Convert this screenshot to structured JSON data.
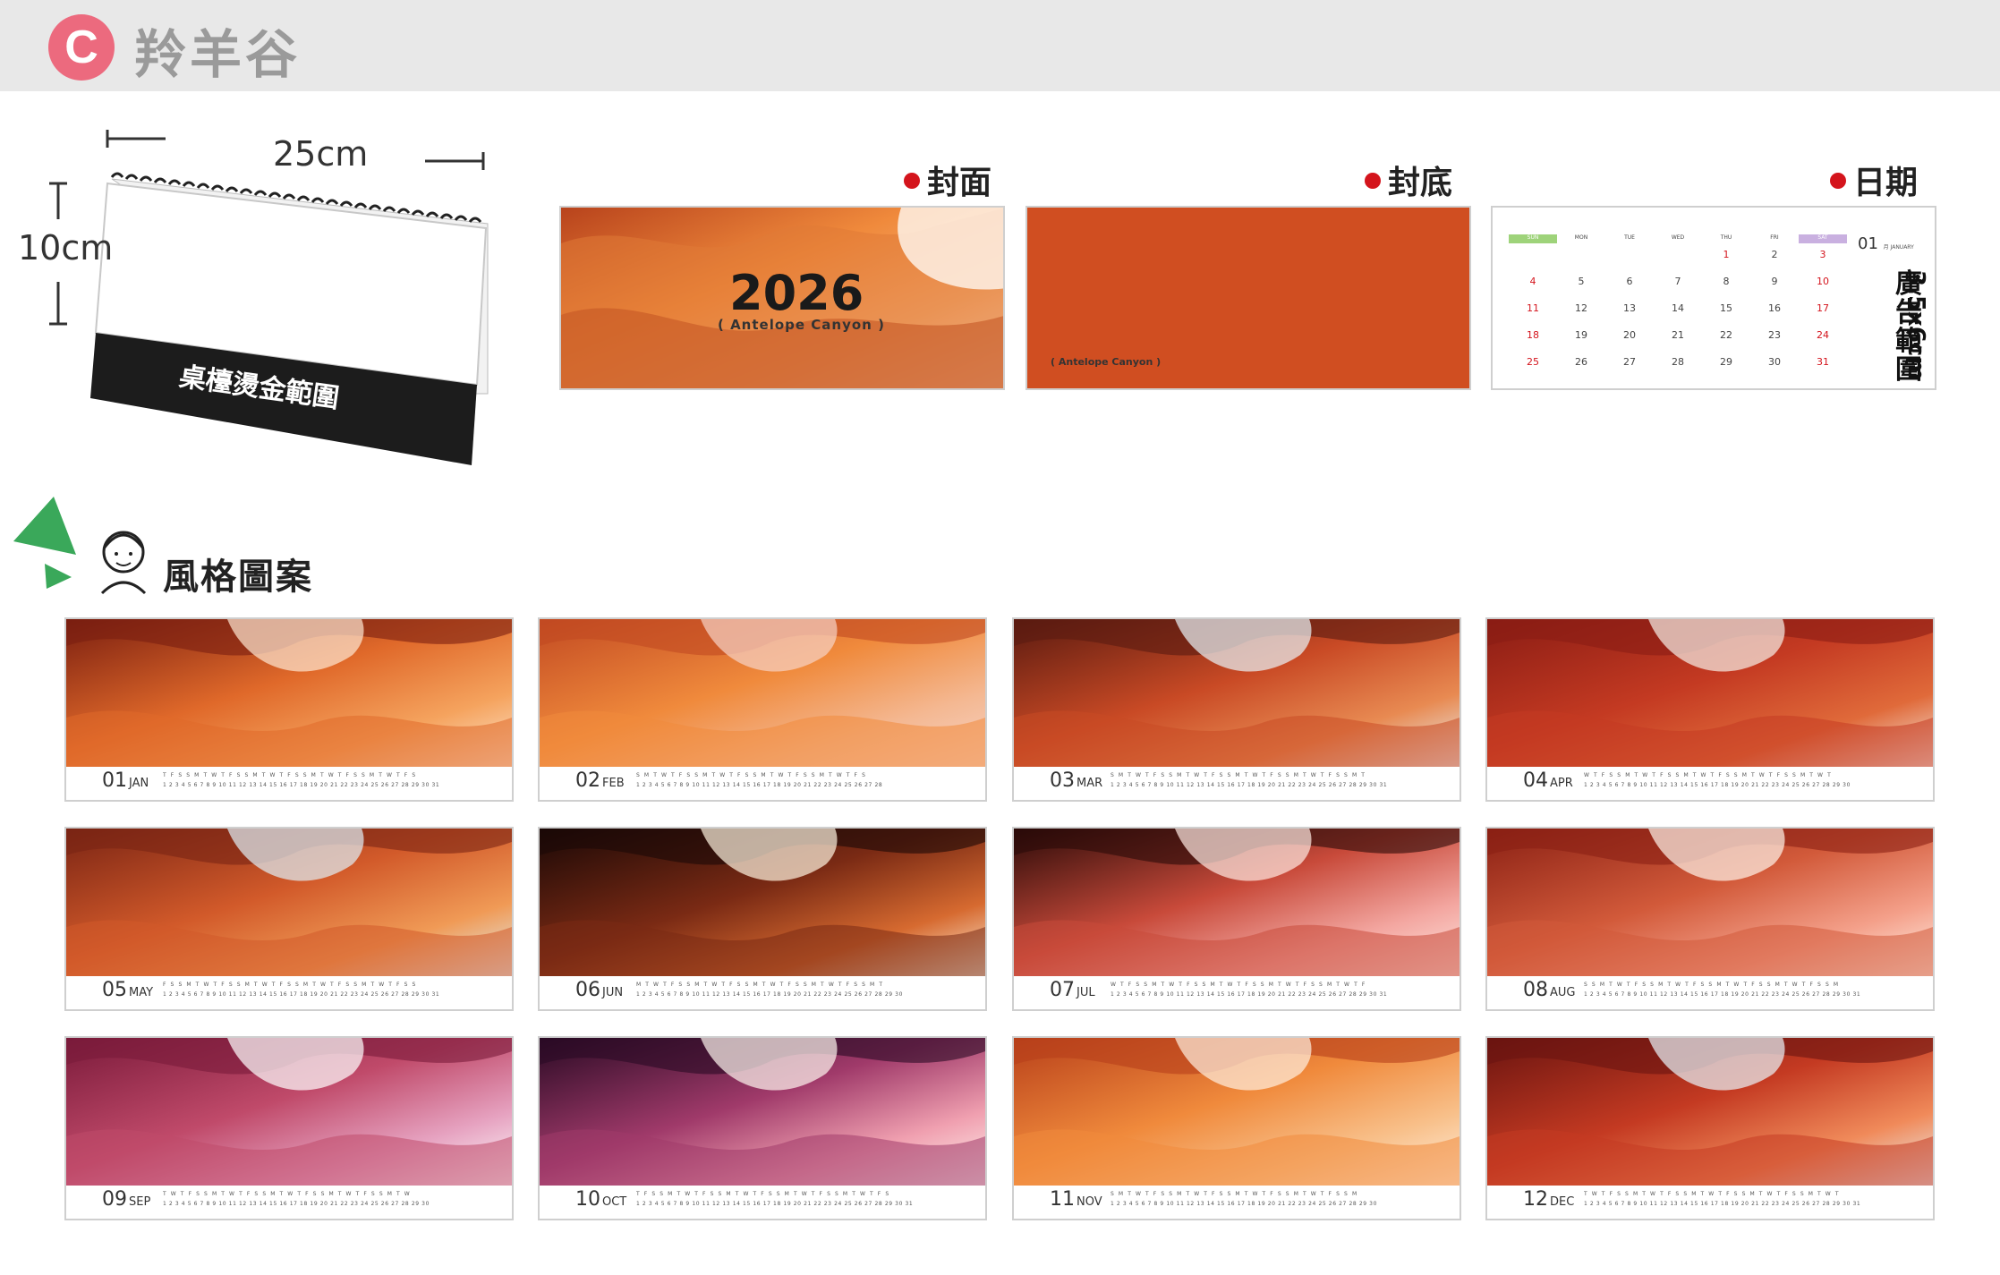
{
  "header": {
    "badge": "C",
    "title": "羚羊谷"
  },
  "mockup": {
    "width_label": "25cm",
    "height_label": "10cm",
    "hot_stamp_label": "桌檯燙金範圍"
  },
  "sections": {
    "cover_label": "封面",
    "back_label": "封底",
    "date_label": "日期",
    "style_label": "風格圖案"
  },
  "cover": {
    "year": "2026",
    "subtitle": "( Antelope Canyon )"
  },
  "back": {
    "subtitle": "( Antelope Canyon )"
  },
  "date_page": {
    "month_num": "01",
    "month_name": "月 JANUARY",
    "ad_text": "廣告範圍",
    "ad_size": "3.5x6cm",
    "weekdays": [
      "SUN",
      "MON",
      "TUE",
      "WED",
      "THU",
      "FRI",
      "SAT"
    ],
    "weeks": [
      [
        "",
        "",
        "",
        "",
        "1",
        "2",
        "3"
      ],
      [
        "4",
        "5",
        "6",
        "7",
        "8",
        "9",
        "10"
      ],
      [
        "11",
        "12",
        "13",
        "14",
        "15",
        "16",
        "17"
      ],
      [
        "18",
        "19",
        "20",
        "21",
        "22",
        "23",
        "24"
      ],
      [
        "25",
        "26",
        "27",
        "28",
        "29",
        "30",
        "31"
      ]
    ]
  },
  "months": [
    {
      "num": "01",
      "abbr": "JAN",
      "days": "T F S S M T W T F S S M T W T F S S M T W T F S S M T W T F S",
      "dates": "1 2 3 4 5 6 7 8 9 10 11 12 13 14 15 16 17 18 19 20 21 22 23 24 25 26 27 28 29 30 31"
    },
    {
      "num": "02",
      "abbr": "FEB",
      "days": "S M T W T F S S M T W T F S S M T W T F S S M T W T F S",
      "dates": "1 2 3 4 5 6 7 8 9 10 11 12 13 14 15 16 17 18 19 20 21 22 23 24 25 26 27 28"
    },
    {
      "num": "03",
      "abbr": "MAR",
      "days": "S M T W T F S S M T W T F S S M T W T F S S M T W T F S S M T",
      "dates": "1 2 3 4 5 6 7 8 9 10 11 12 13 14 15 16 17 18 19 20 21 22 23 24 25 26 27 28 29 30 31"
    },
    {
      "num": "04",
      "abbr": "APR",
      "days": "W T F S S M T W T F S S M T W T F S S M T W T F S S M T W T",
      "dates": "1 2 3 4 5 6 7 8 9 10 11 12 13 14 15 16 17 18 19 20 21 22 23 24 25 26 27 28 29 30"
    },
    {
      "num": "05",
      "abbr": "MAY",
      "days": "F S S M T W T F S S M T W T F S S M T W T F S S M T W T F S S",
      "dates": "1 2 3 4 5 6 7 8 9 10 11 12 13 14 15 16 17 18 19 20 21 22 23 24 25 26 27 28 29 30 31"
    },
    {
      "num": "06",
      "abbr": "JUN",
      "days": "M T W T F S S M T W T F S S M T W T F S S M T W T F S S M T",
      "dates": "1 2 3 4 5 6 7 8 9 10 11 12 13 14 15 16 17 18 19 20 21 22 23 24 25 26 27 28 29 30"
    },
    {
      "num": "07",
      "abbr": "JUL",
      "days": "W T F S S M T W T F S S M T W T F S S M T W T F S S M T W T F",
      "dates": "1 2 3 4 5 6 7 8 9 10 11 12 13 14 15 16 17 18 19 20 21 22 23 24 25 26 27 28 29 30 31"
    },
    {
      "num": "08",
      "abbr": "AUG",
      "days": "S S M T W T F S S M T W T F S S M T W T F S S M T W T F S S M",
      "dates": "1 2 3 4 5 6 7 8 9 10 11 12 13 14 15 16 17 18 19 20 21 22 23 24 25 26 27 28 29 30 31"
    },
    {
      "num": "09",
      "abbr": "SEP",
      "days": "T W T F S S M T W T F S S M T W T F S S M T W T F S S M T W",
      "dates": "1 2 3 4 5 6 7 8 9 10 11 12 13 14 15 16 17 18 19 20 21 22 23 24 25 26 27 28 29 30"
    },
    {
      "num": "10",
      "abbr": "OCT",
      "days": "T F S S M T W T F S S M T W T F S S M T W T F S S M T W T F S",
      "dates": "1 2 3 4 5 6 7 8 9 10 11 12 13 14 15 16 17 18 19 20 21 22 23 24 25 26 27 28 29 30 31"
    },
    {
      "num": "11",
      "abbr": "NOV",
      "days": "S M T W T F S S M T W T F S S M T W T F S S M T W T F S S M",
      "dates": "1 2 3 4 5 6 7 8 9 10 11 12 13 14 15 16 17 18 19 20 21 22 23 24 25 26 27 28 29 30"
    },
    {
      "num": "12",
      "abbr": "DEC",
      "days": "T W T F S S M T W T F S S M T W T F S S M T W T F S S M T W T",
      "dates": "1 2 3 4 5 6 7 8 9 10 11 12 13 14 15 16 17 18 19 20 21 22 23 24 25 26 27 28 29 30 31"
    }
  ],
  "colors": {
    "badge": "#ec6a7e",
    "back_cover": "#d04e21",
    "accent_dot": "#d4141c",
    "arrow_green": "#3aa85a"
  }
}
